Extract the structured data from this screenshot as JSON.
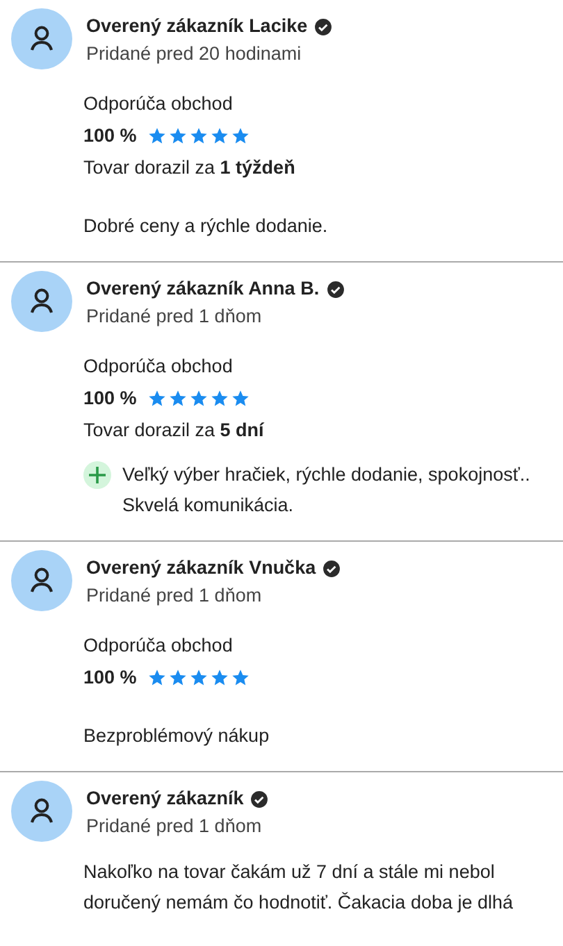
{
  "reviews": [
    {
      "author": "Overený zákazník Lacike",
      "verified": true,
      "added": "Pridané pred 20 hodinami",
      "recommend_label": "Odporúča obchod",
      "percent": "100 %",
      "stars": 5,
      "delivery": "Tovar dorazil za **1 týždeň**",
      "comment": {
        "kind": "plain",
        "text": "Dobré ceny a rýchle dodanie."
      }
    },
    {
      "author": "Overený zákazník Anna B.",
      "verified": true,
      "added": "Pridané pred 1 dňom",
      "recommend_label": "Odporúča obchod",
      "percent": "100 %",
      "stars": 5,
      "delivery": "Tovar dorazil za **5 dní**",
      "comment": {
        "kind": "pro",
        "text": "Veľký výber hračiek, rýchle dodanie, spokojnosť.. Skvelá komunikácia."
      }
    },
    {
      "author": "Overený zákazník Vnučka",
      "verified": true,
      "added": "Pridané pred 1 dňom",
      "recommend_label": "Odporúča obchod",
      "percent": "100 %",
      "stars": 5,
      "comment": {
        "kind": "plain",
        "text": "Bezproblémový nákup"
      }
    },
    {
      "author": "Overený zákazník",
      "verified": true,
      "added": "Pridané pred 1 dňom",
      "comment": {
        "kind": "plain",
        "text": "Nakoľko na tovar čakám už 7 dní a stále mi nebol doručený nemám čo hodnotiť. Čakacia doba je dlhá"
      }
    }
  ]
}
